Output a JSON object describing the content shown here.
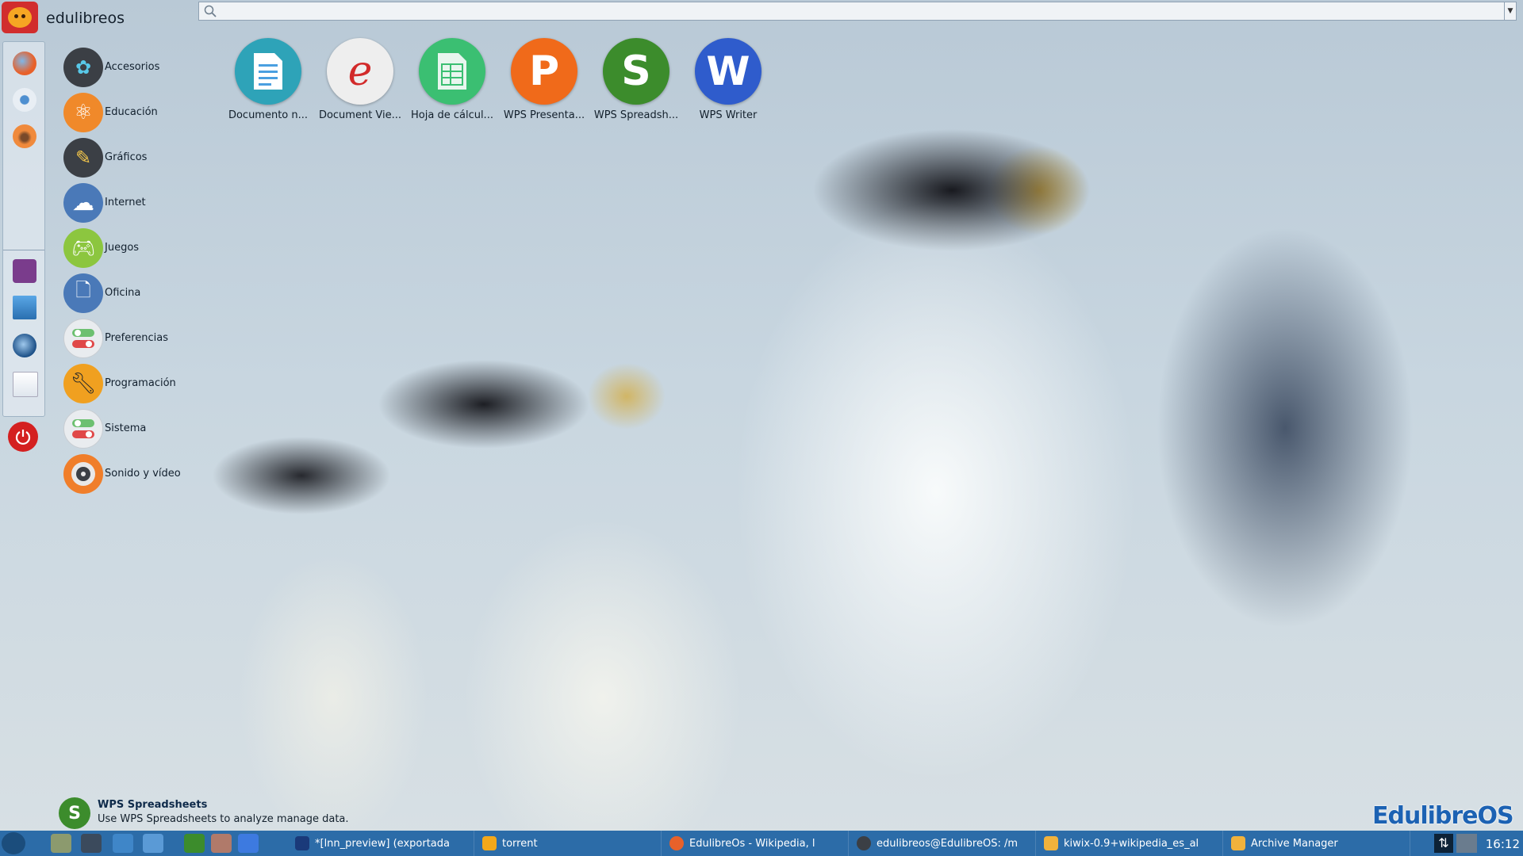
{
  "top": {
    "title": "edulibreos"
  },
  "search": {
    "value": "",
    "placeholder": ""
  },
  "categories": [
    {
      "label": "Accesorios",
      "icon": "accessories-icon",
      "color": "#3b3f45"
    },
    {
      "label": "Educación",
      "icon": "atom-icon",
      "color": "#f0892a"
    },
    {
      "label": "Gráficos",
      "icon": "graphics-icon",
      "color": "#3b3f45"
    },
    {
      "label": "Internet",
      "icon": "cloud-icon",
      "color": "#4a79b8"
    },
    {
      "label": "Juegos",
      "icon": "gamepad-icon",
      "color": "#8cc63f"
    },
    {
      "label": "Oficina",
      "icon": "document-icon",
      "color": "#4a79b8"
    },
    {
      "label": "Preferencias",
      "icon": "toggle-icon",
      "color": "#e9ecef"
    },
    {
      "label": "Programación",
      "icon": "wrench-icon",
      "color": "#f0a020"
    },
    {
      "label": "Sistema",
      "icon": "toggle-icon",
      "color": "#e9ecef"
    },
    {
      "label": "Sonido y vídeo",
      "icon": "speaker-icon",
      "color": "#f07e2a"
    }
  ],
  "apps": [
    {
      "label": "Documento n...",
      "icon": "text-document-icon",
      "color": "#2ea3b8",
      "glyph": "≡"
    },
    {
      "label": "Document Vie...",
      "icon": "document-viewer-icon",
      "color": "#eeeeee",
      "glyph": "e"
    },
    {
      "label": "Hoja de cálcul...",
      "icon": "spreadsheet-icon",
      "color": "#3bbf72",
      "glyph": "▦"
    },
    {
      "label": "WPS Presenta...",
      "icon": "wps-presentation-icon",
      "color": "#f06a1a",
      "glyph": "P"
    },
    {
      "label": "WPS Spreadsh...",
      "icon": "wps-spreadsheets-icon",
      "color": "#3c8c2c",
      "glyph": "S"
    },
    {
      "label": "WPS Writer",
      "icon": "wps-writer-icon",
      "color": "#2f5ccc",
      "glyph": "W"
    }
  ],
  "description": {
    "title": "WPS Spreadsheets",
    "text": "Use WPS Spreadsheets to analyze manage data.",
    "glyph": "S"
  },
  "brand": "EdulibreOS",
  "taskbar": {
    "tasks": [
      {
        "label": "*[lnn_preview] (exportada",
        "color": "#1a3a7a"
      },
      {
        "label": "torrent",
        "color": "#f3a81a"
      },
      {
        "label": "EdulibreOs - Wikipedia, l",
        "color": "#e8612a"
      },
      {
        "label": "edulibreos@EdulibreOS: /m",
        "color": "#3b3f45"
      },
      {
        "label": "kiwix-0.9+wikipedia_es_al",
        "color": "#f1b23c"
      },
      {
        "label": "Archive Manager",
        "color": "#f1b23c"
      }
    ],
    "tray_symbol": "⇅",
    "clock": "16:12"
  }
}
